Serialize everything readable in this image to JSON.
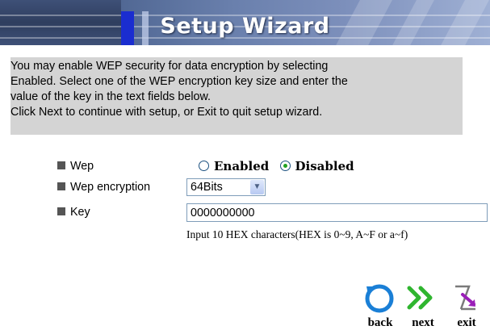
{
  "header": {
    "title": "Setup Wizard"
  },
  "description": {
    "lines": [
      "You may enable WEP security for data encryption by selecting",
      "Enabled. Select one of the WEP encryption key size and enter the",
      "value of the key in the text fields below.",
      "Click Next to continue with setup, or Exit to quit setup wizard."
    ]
  },
  "form": {
    "wep": {
      "label": "Wep",
      "options": {
        "enabled": "Enabled",
        "disabled": "Disabled"
      },
      "selected": "Disabled"
    },
    "encryption": {
      "label": "Wep encryption",
      "selected": "64Bits"
    },
    "key": {
      "label": "Key",
      "value": "0000000000"
    },
    "hint": "Input 10 HEX characters(HEX is 0~9, A~F or a~f)"
  },
  "nav": {
    "back": {
      "label": "back",
      "icon": "back-arrow-icon"
    },
    "next": {
      "label": "next",
      "icon": "double-chevron-right-icon"
    },
    "exit": {
      "label": "exit",
      "icon": "exit-arrow-icon"
    }
  },
  "colors": {
    "header_blue": "#1a2dd0",
    "back_icon": "#1a7fd6",
    "next_icon": "#2fb52f",
    "exit_icon": "#9a1fb8",
    "description_bg": "#d4d4d4",
    "radio_dot": "#21a121"
  }
}
